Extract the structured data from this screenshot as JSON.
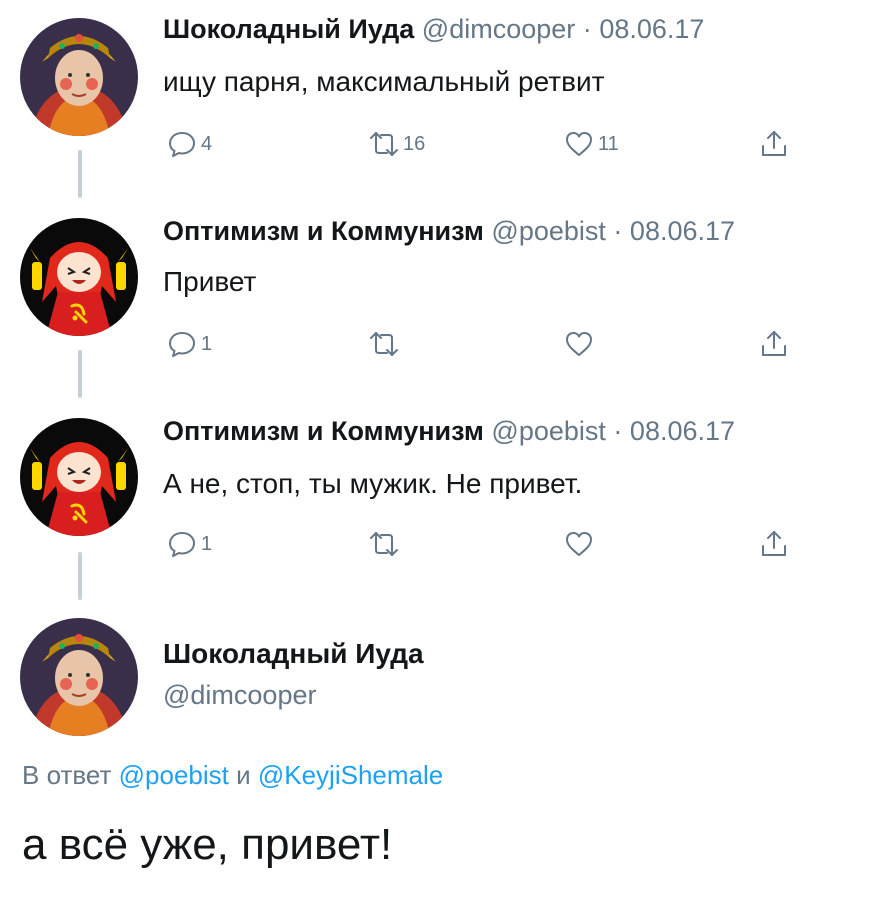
{
  "colors": {
    "text": "#14171a",
    "muted": "#657786",
    "link": "#1da1f2",
    "thread": "#c4cfd6"
  },
  "tweets": [
    {
      "name": "Шоколадный Иуда",
      "handle": "@dimcooper",
      "sep": "·",
      "date": "08.06.17",
      "text": "ищу парня, максимальный ретвит",
      "replies": "4",
      "retweets": "16",
      "likes": "11",
      "avatar": "avatar-woman-icon"
    },
    {
      "name": "Оптимизм и Коммунизм",
      "handle": "@poebist",
      "sep": "·",
      "date": "08.06.17",
      "text": "Привет",
      "replies": "1",
      "retweets": "",
      "likes": "",
      "avatar": "avatar-anime-icon"
    },
    {
      "name": "Оптимизм и Коммунизм",
      "handle": "@poebist",
      "sep": "·",
      "date": "08.06.17",
      "text": "А не, стоп, ты мужик. Не привет.",
      "replies": "1",
      "retweets": "",
      "likes": "",
      "avatar": "avatar-anime-icon"
    }
  ],
  "main_tweet": {
    "name": "Шоколадный Иуда",
    "handle": "@dimcooper",
    "reply_prefix": "В ответ",
    "reply_mention_1": "@poebist",
    "reply_and": "и",
    "reply_mention_2": "@KeyjiShemale",
    "text": "а всё уже, привет!",
    "avatar": "avatar-woman-icon"
  }
}
